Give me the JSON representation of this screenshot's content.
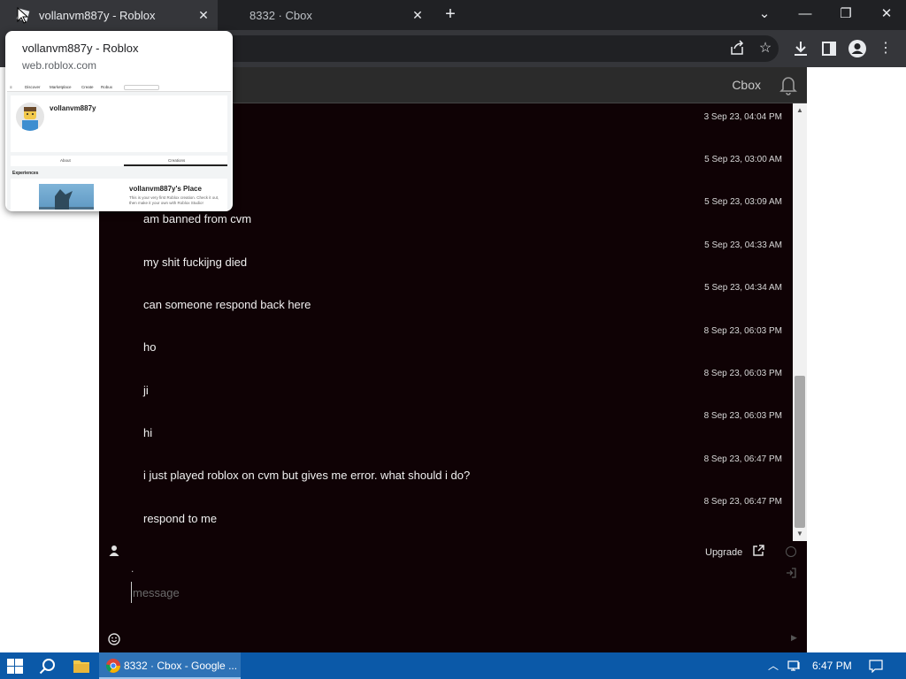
{
  "browser": {
    "tabs": [
      {
        "title": "vollanvm887y - Roblox",
        "active": true
      },
      {
        "title": "8332 · Cbox",
        "active": false
      }
    ],
    "window_controls": [
      "minimize",
      "maximize",
      "close"
    ]
  },
  "preview": {
    "title": "vollanvm887y - Roblox",
    "url": "web.roblox.com",
    "thumbnail": {
      "nav": [
        "Discover",
        "Marketplace",
        "Create",
        "Robux"
      ],
      "username": "vollanvm887y",
      "tabs": [
        "About",
        "Creations"
      ],
      "section": "Experiences",
      "place_title": "vollanvm887y's Place",
      "place_desc": "This is your very first Roblox creation. Check it out, then make it your own with Roblox Studio!"
    }
  },
  "cbox": {
    "header_title": "Cbox",
    "messages": [
      {
        "time": "3 Sep 23, 04:04 PM",
        "text": ""
      },
      {
        "time": "5 Sep 23, 03:00 AM",
        "text": ""
      },
      {
        "time": "5 Sep 23, 03:09 AM",
        "text": "am banned from cvm"
      },
      {
        "time": "5 Sep 23, 04:33 AM",
        "text": "my shit fuckijng died"
      },
      {
        "time": "5 Sep 23, 04:34 AM",
        "text": "can someone respond back here"
      },
      {
        "time": "8 Sep 23, 06:03 PM",
        "text": "ho"
      },
      {
        "time": "8 Sep 23, 06:03 PM",
        "text": "ji"
      },
      {
        "time": "8 Sep 23, 06:03 PM",
        "text": "hi"
      },
      {
        "time": "8 Sep 23, 06:47 PM",
        "text": "i just played roblox on cvm but gives me error. what should i do?"
      },
      {
        "time": "8 Sep 23, 06:47 PM",
        "text": "respond to me"
      }
    ],
    "composer": {
      "upgrade_label": "Upgrade",
      "name_dot": ".",
      "placeholder": "message"
    }
  },
  "taskbar": {
    "chrome_label": "8332 · Cbox - Google ...",
    "clock": "6:47 PM"
  },
  "colors": {
    "chat_bg": "#0f0205",
    "taskbar": "#0b59a8",
    "chrome_dark": "#202124"
  }
}
